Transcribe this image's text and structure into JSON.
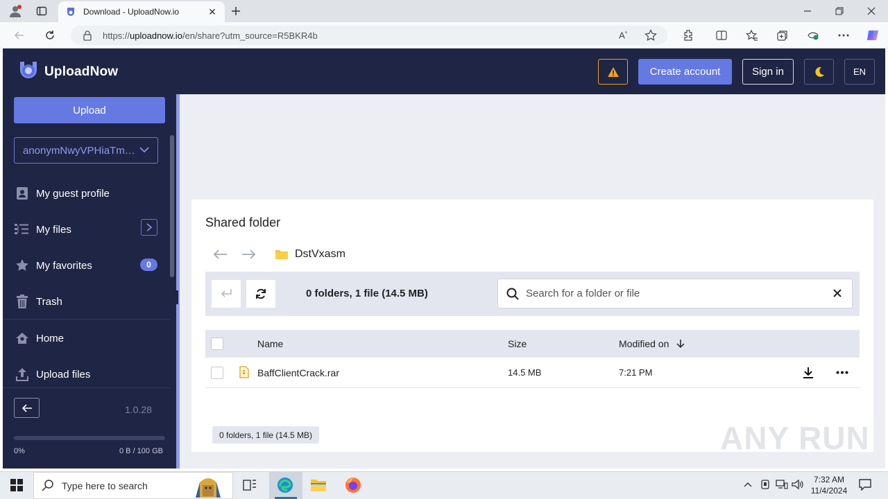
{
  "browser": {
    "tab_title": "Download - UploadNow.io",
    "url_prefix": "https://",
    "url_host": "uploadnow.io",
    "url_path": "/en/share?utm_source=R5BKR4b"
  },
  "header": {
    "brand": "UploadNow",
    "create_account": "Create account",
    "sign_in": "Sign in",
    "language": "EN"
  },
  "sidebar": {
    "upload_label": "Upload",
    "account": "anonymNwyVPHiaTmsmJ",
    "items": [
      {
        "label": "My guest profile",
        "icon": "profile-icon"
      },
      {
        "label": "My files",
        "icon": "files-tree-icon"
      },
      {
        "label": "My favorites",
        "icon": "star-icon",
        "badge": "0"
      },
      {
        "label": "Trash",
        "icon": "trash-icon"
      },
      {
        "label": "Home",
        "icon": "home-icon"
      },
      {
        "label": "Upload files",
        "icon": "upload-icon"
      }
    ],
    "version": "1.0.28",
    "storage_pct_label": "0%",
    "storage_used_label": "0 B / 100 GB",
    "storage_fraction": 0
  },
  "main": {
    "title": "Shared folder",
    "folder_name": "DstVxasm",
    "count_summary": "0 folders, 1 file (14.5 MB)",
    "search_placeholder": "Search for a folder or file",
    "columns": {
      "name": "Name",
      "size": "Size",
      "modified": "Modified on"
    },
    "files": [
      {
        "name": "BaffClientCrack.rar",
        "size": "14.5 MB",
        "modified": "7:21 PM"
      }
    ],
    "footer_summary": "0 folders, 1 file (14.5 MB)"
  },
  "watermark": "ANY RUN",
  "taskbar": {
    "search_placeholder": "Type here to search",
    "time": "7:32 AM",
    "date": "11/4/2024"
  },
  "colors": {
    "navy": "#1f2544",
    "accent": "#6579e3",
    "warning": "#f0a020"
  }
}
